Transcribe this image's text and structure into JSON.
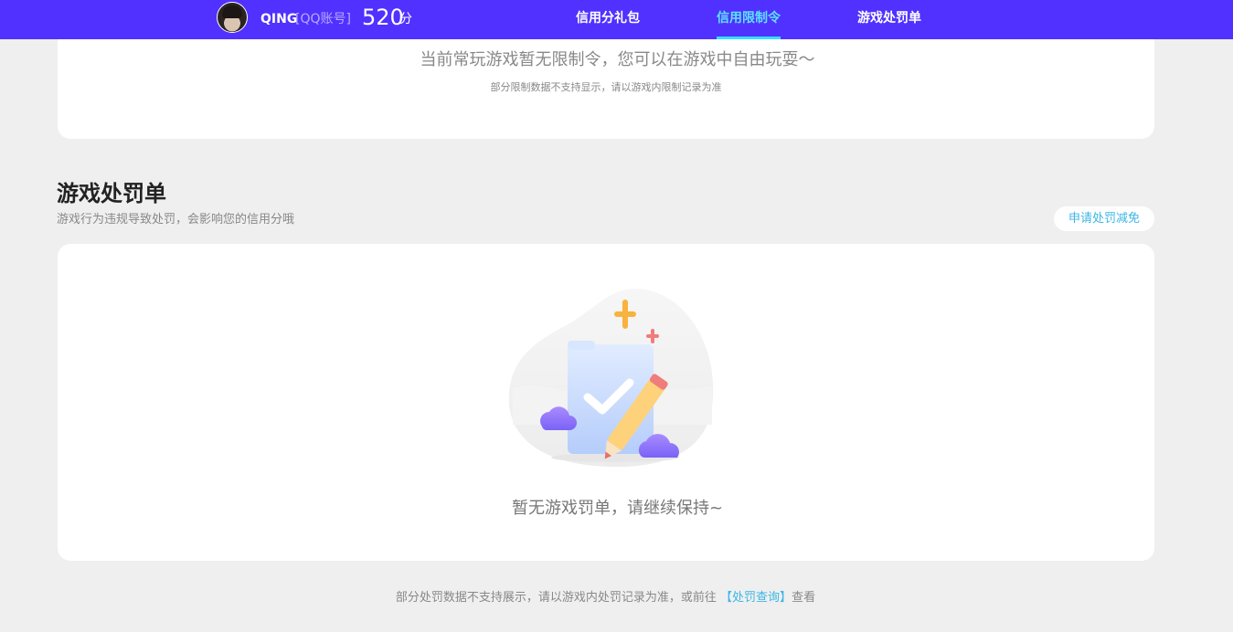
{
  "header": {
    "username": "QING",
    "account_type": "[QQ账号]",
    "score": "520",
    "score_unit": "分",
    "tabs": [
      {
        "label": "信用分礼包",
        "active": false
      },
      {
        "label": "信用限制令",
        "active": true
      },
      {
        "label": "游戏处罚单",
        "active": false
      }
    ],
    "accent_color": "#5131ff",
    "active_color": "#5ce2ff"
  },
  "limit_section": {
    "message": "当前常玩游戏暂无限制令，您可以在游戏中自由玩耍～",
    "note": "部分限制数据不支持显示，请以游戏内限制记录为准"
  },
  "penalty_section": {
    "title": "游戏处罚单",
    "subtitle": "游戏行为违规导致处罚，会影响您的信用分哦",
    "appeal_button": "申请处罚减免",
    "empty_message": "暂无游戏罚单，请继续保持~"
  },
  "footer": {
    "prefix": "部分处罚数据不支持展示，请以游戏内处罚记录为准，或前往 ",
    "link_text": "【处罚查询】",
    "suffix": "查看"
  }
}
